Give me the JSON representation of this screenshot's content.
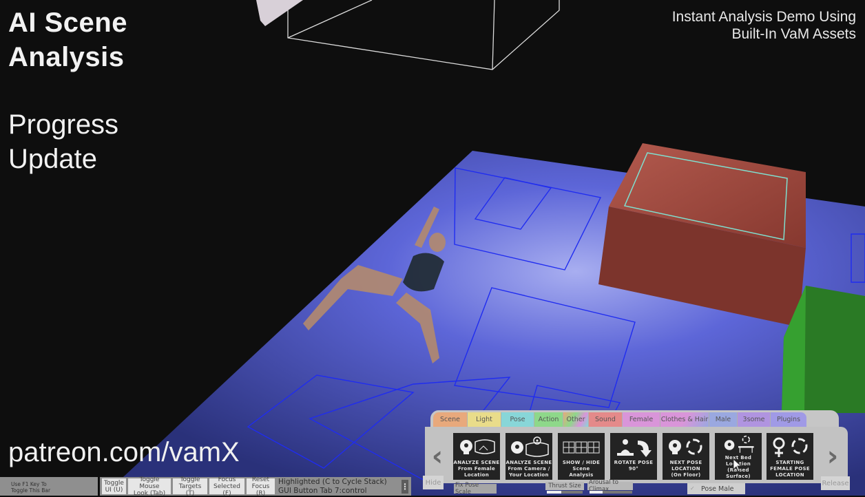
{
  "overlay": {
    "title_line1": "AI Scene",
    "title_line2": "Analysis",
    "subtitle_line1": "Progress",
    "subtitle_line2": "Update",
    "tagline_line1": "Instant Analysis Demo Using",
    "tagline_line2": "Built-In VaM Assets",
    "patreon": "patreon.com/vamX"
  },
  "scene": {
    "floor_color": "#4a55c8",
    "grid_line_color": "#1a2aff",
    "bed_color": "#8a3a30",
    "bed_outline_color": "#7fe0d0",
    "green_block_color": "#2f8a2a",
    "wireframe_color": "#e0e0e0",
    "figure": "3d-character-lying-on-floor"
  },
  "bottom_bar": {
    "f1_hint": "Use F1 Key To\nToggle This Bar",
    "buttons": [
      {
        "label": "Toggle\nUI (U)"
      },
      {
        "label": "Toggle Mouse\nLook (Tab)"
      },
      {
        "label": "Toggle\nTargets (T)"
      },
      {
        "label": "Focus\nSelected (F)"
      },
      {
        "label": "Reset\nFocus (R)"
      }
    ],
    "highlighted_line1": "Highlighted (C to Cycle Stack)",
    "highlighted_line2": "GUI  Button  Tab  7:control",
    "menu_icon": "kebab-menu-icon"
  },
  "vamx": {
    "tabs": [
      {
        "label": "Scene",
        "color": "#e8a97c"
      },
      {
        "label": "Light",
        "color": "#e9dc8a"
      },
      {
        "label": "Pose",
        "color": "#88d6d8"
      },
      {
        "label": "Action",
        "color": "#8ed88a"
      },
      {
        "label": "Other",
        "color": "#d6c08a"
      },
      {
        "label": "Sound",
        "color": "#e48a8a"
      },
      {
        "label": "Female",
        "color": "#d995d9"
      },
      {
        "label": "Clothes & Hair",
        "color": "#d29ad8"
      },
      {
        "label": "Male",
        "color": "#9aa8e0"
      },
      {
        "label": "3some",
        "color": "#b094e0"
      },
      {
        "label": "Plugins",
        "color": "#a09ae6"
      }
    ],
    "prev_icon": "chevron-left-icon",
    "next_icon": "chevron-right-icon",
    "cards": [
      {
        "label": "ANALYZE SCENE\nFrom Female\nLocation",
        "icon": "head-gear-panorama-icon"
      },
      {
        "label": "ANALYZE SCENE\nFrom Camera /\nYour Location",
        "icon": "head-gear-panorama-target-icon"
      },
      {
        "label": "SHOW / HIDE\nScene\nAnalysis",
        "icon": "grid-frames-icon"
      },
      {
        "label": "ROTATE POSE\n90°",
        "icon": "person-rotate-icon"
      },
      {
        "label": "NEXT POSE\nLOCATION\n(On Floor)",
        "icon": "head-gear-cycle-icon"
      },
      {
        "label": "Next Bed\nLocation\n(Raised Surface)",
        "icon": "head-gear-table-icon"
      },
      {
        "label": "STARTING\nFEMALE POSE\nLOCATION",
        "icon": "female-cycle-icon"
      }
    ],
    "hide_label": "Hide",
    "release_label": "Release",
    "fix_pose_scale": "Fix Pose Scale",
    "thrust_size": {
      "label": "Thrust Size",
      "value": 0.4
    },
    "arousal": {
      "label": "Arousal to Climax",
      "value": 0.3
    },
    "pose_male": {
      "label": "Pose Male",
      "checked": true
    }
  }
}
